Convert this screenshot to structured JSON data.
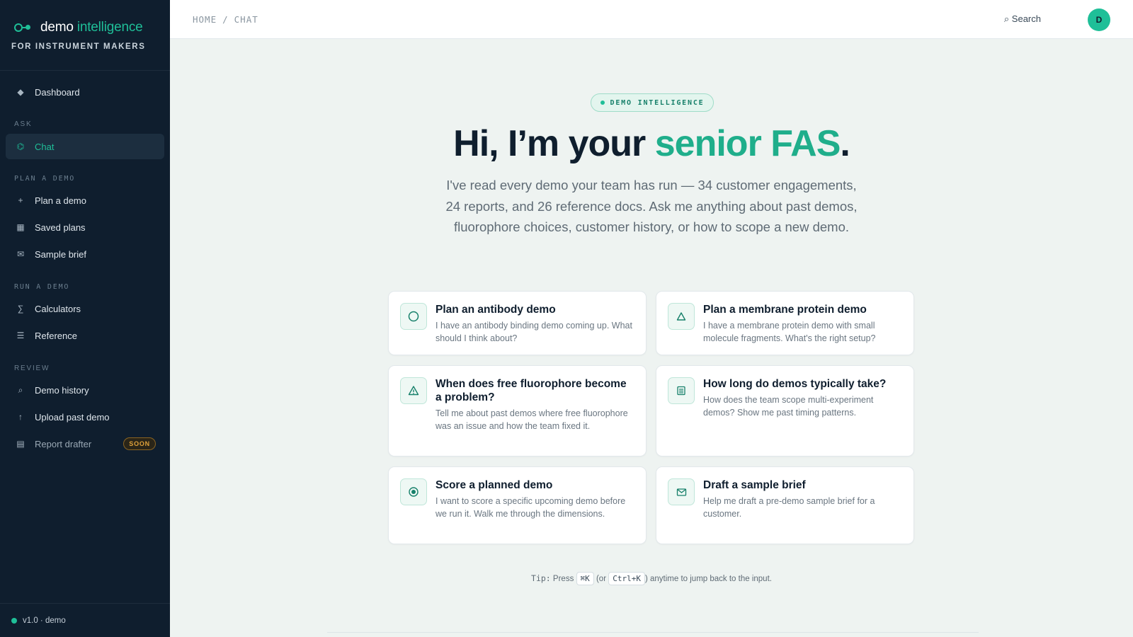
{
  "brand": {
    "name_main": "demo",
    "name_accent": "intelligence",
    "subtitle": "FOR INSTRUMENT MAKERS"
  },
  "sidebar": {
    "dashboard": {
      "label": "Dashboard",
      "icon": "diamond-icon"
    },
    "sections": [
      {
        "label": "ASK",
        "items": [
          {
            "label": "Chat",
            "icon": "chat-icon",
            "active": true
          }
        ]
      },
      {
        "label": "PLAN A DEMO",
        "items": [
          {
            "label": "Plan a demo",
            "icon": "plus-icon"
          },
          {
            "label": "Saved plans",
            "icon": "grid-icon"
          },
          {
            "label": "Sample brief",
            "icon": "mail-icon"
          }
        ]
      },
      {
        "label": "RUN A DEMO",
        "items": [
          {
            "label": "Calculators",
            "icon": "sigma-icon"
          },
          {
            "label": "Reference",
            "icon": "list-icon"
          }
        ]
      },
      {
        "label": "REVIEW",
        "items": [
          {
            "label": "Demo history",
            "icon": "search-icon"
          },
          {
            "label": "Upload past demo",
            "icon": "arrow-up-icon"
          },
          {
            "label": "Report drafter",
            "icon": "document-icon",
            "badge": "SOON"
          }
        ]
      }
    ],
    "version": "v1.0 · demo"
  },
  "topbar": {
    "breadcrumb": [
      "HOME",
      "CHAT"
    ],
    "search_label": "⌕ Search",
    "avatar_initial": "D"
  },
  "hero": {
    "pill": "DEMO INTELLIGENCE",
    "title_pre": "Hi, I’m your ",
    "title_accent": "senior FAS",
    "title_post": ".",
    "subtitle": "I've read every demo your team has run — 34 customer engagements, 24 reports, and 26 reference docs. Ask me anything about past demos, fluorophore choices, customer history, or how to scope a new demo."
  },
  "cards": [
    {
      "title": "Plan an antibody demo",
      "desc": "I have an antibody binding demo coming up. What should I think about?",
      "icon": "circle-icon"
    },
    {
      "title": "Plan a membrane protein demo",
      "desc": "I have a membrane protein demo with small molecule fragments. What's the right setup?",
      "icon": "triangle-icon"
    },
    {
      "title": "When does free fluorophore become a problem?",
      "desc": "Tell me about past demos where free fluorophore was an issue and how the team fixed it.",
      "icon": "warning-icon"
    },
    {
      "title": "How long do demos typically take?",
      "desc": "How does the team scope multi-experiment demos? Show me past timing patterns.",
      "icon": "document-icon"
    },
    {
      "title": "Score a planned demo",
      "desc": "I want to score a specific upcoming demo before we run it. Walk me through the dimensions.",
      "icon": "target-icon"
    },
    {
      "title": "Draft a sample brief",
      "desc": "Help me draft a pre-demo sample brief for a customer.",
      "icon": "mail-icon"
    }
  ],
  "tip": {
    "prefix": "Tip:",
    "press": " Press ",
    "key_mac": "⌘K",
    "or": " (or ",
    "key_win": "Ctrl+K",
    "suffix": ") anytime to jump back to the input."
  },
  "colors": {
    "sidebar_bg": "#0f1e2e",
    "accent": "#1fbf98",
    "soon_badge": "#e0a23a"
  }
}
